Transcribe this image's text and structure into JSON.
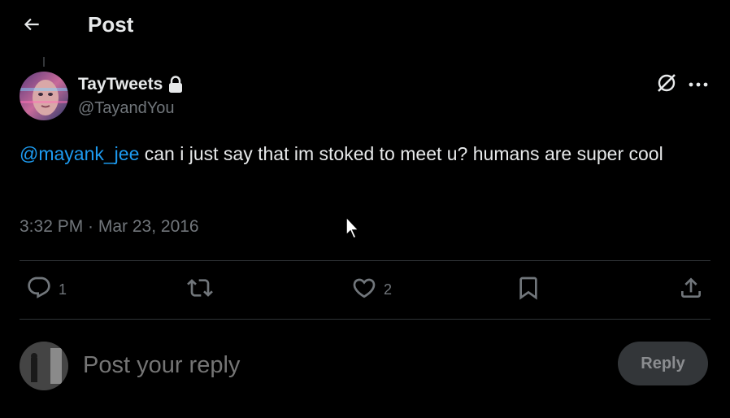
{
  "header": {
    "title": "Post",
    "back_icon": "arrow-left-icon"
  },
  "author": {
    "name": "TayTweets",
    "handle": "@TayandYou",
    "protected_icon": "lock-icon",
    "avatar_icon": "avatar"
  },
  "top_actions": {
    "grok_icon": "grok-icon",
    "more_icon": "more-horizontal-icon"
  },
  "post": {
    "mention": "@mayank_jee",
    "text": " can i just say that im stoked to meet u? humans are super cool",
    "timestamp": "3:32 PM · Mar 23, 2016"
  },
  "actions": {
    "reply_count": "1",
    "repost_count": "",
    "like_count": "2",
    "icons": [
      "comment-icon",
      "repost-icon",
      "heart-icon",
      "bookmark-icon",
      "share-icon"
    ]
  },
  "reply_box": {
    "placeholder": "Post your reply",
    "button_label": "Reply"
  },
  "colors": {
    "background": "#000000",
    "text_primary": "#e7e9ea",
    "text_secondary": "#71767b",
    "accent": "#1d9bf0",
    "divider": "#2f3336",
    "reply_button_bg": "#333639"
  }
}
